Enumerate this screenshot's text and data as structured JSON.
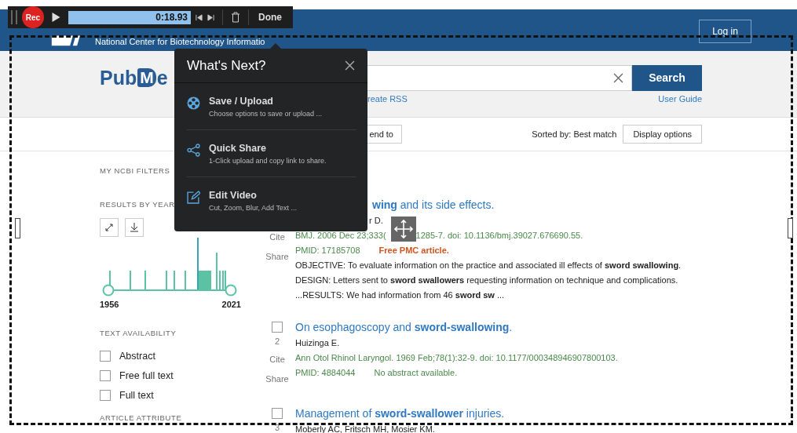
{
  "recorder": {
    "rec_label": "Rec",
    "time": "0:18.93",
    "level": 1,
    "done_label": "Done"
  },
  "header": {
    "org_name": "National Center for Biotechnology Informatio",
    "login_label": "Log in"
  },
  "logo": {
    "part_1": "Pub",
    "part_2": "M",
    "part_3": "e"
  },
  "search": {
    "button_label": "Search",
    "links": [
      "reate RSS",
      "User Guide"
    ]
  },
  "toolbar": {
    "send_to_label": "end to",
    "sort_label": "Sorted by: Best match",
    "display_label": "Display options"
  },
  "sidebar": {
    "filters_heading": "MY NCBI FILTERS",
    "year_heading": "RESULTS BY YEAR",
    "year_start": "1956",
    "year_end": "2021",
    "availability_heading": "TEXT AVAILABILITY",
    "availability": [
      {
        "label": "Abstract",
        "checked": false
      },
      {
        "label": "Free full text",
        "checked": false
      },
      {
        "label": "Full text",
        "checked": false
      }
    ],
    "attribute_heading": "ARTICLE ATTRIBUTE"
  },
  "results": [
    {
      "title": "**wing** and its side effects.",
      "authors": "r D.",
      "citation": [
        "BMJ. 2006 Dec 23;333(",
        "1285-7. doi: 10.1136/bmj.39027.676690.55."
      ],
      "pmid": "PMID: 17185708",
      "note": {
        "kind": "free",
        "text": "Free PMC article."
      },
      "actions": [
        "Cite",
        "Share"
      ],
      "snippet": [
        "OBJECTIVE: To evaluate information on the practice and associated ill effects of **sword swallowing**.",
        "DESIGN: Letters sent to **sword swallowers** requesting information on technique and complications.",
        "...RESULTS: We had information from 46 **sword sw** ..."
      ]
    },
    {
      "checked": false,
      "number": "2",
      "title": "On esophagoscopy and **sword-swallowing**.",
      "authors": "Huizinga E.",
      "citation": [
        "Ann Otol Rhinol Laryngol. 1969 Feb;78(1):32-9. doi: 10.1177/000348946907800103."
      ],
      "pmid": "PMID: 4884044",
      "note": {
        "kind": "plain",
        "text": "No abstract available."
      },
      "actions": [
        "Cite",
        "Share"
      ]
    },
    {
      "checked": false,
      "number": "3",
      "title": "Management of **sword-swallower** injuries.",
      "authors": "Moberly AC, Fritsch MH, Mosier KM."
    }
  ],
  "popup": {
    "title": "What's Next?",
    "items": [
      {
        "kind": "film",
        "title": "Save / Upload",
        "description": "Choose options to save or upload ..."
      },
      {
        "kind": "share",
        "title": "Quick Share",
        "description": "1-Click upload and copy link to share."
      },
      {
        "kind": "edit",
        "title": "Edit Video",
        "description": "Cut, Zoom, Blur, Add Text ..."
      }
    ]
  }
}
